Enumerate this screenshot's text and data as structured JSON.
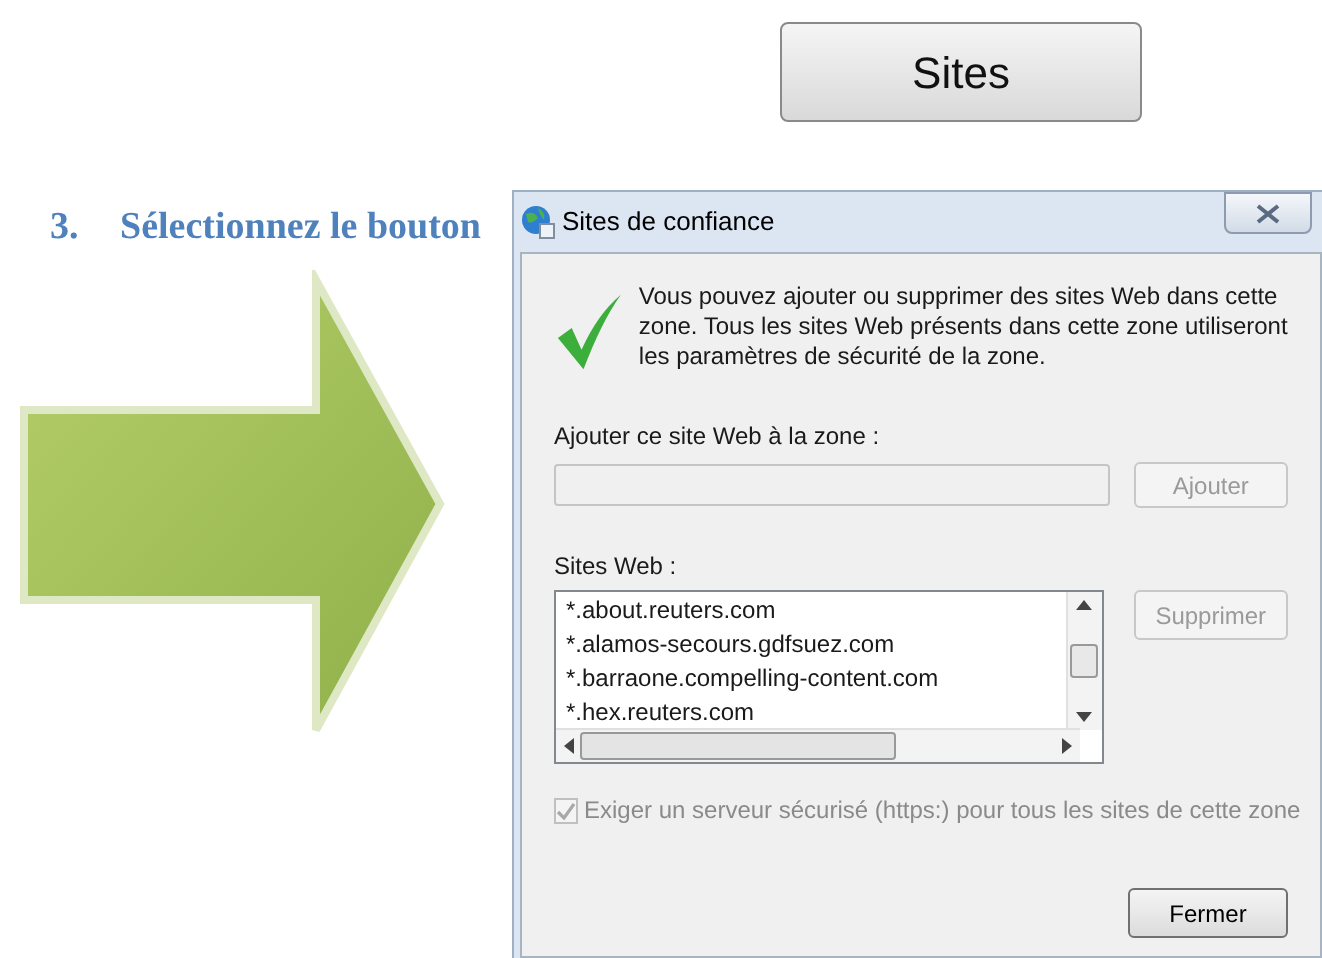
{
  "heading": {
    "number": "3.",
    "text": "Sélectionnez le bouton"
  },
  "sites_button": {
    "label": "Sites"
  },
  "dialog": {
    "title": "Sites de confiance",
    "message": "Vous pouvez ajouter ou supprimer des sites Web dans cette zone. Tous les sites Web présents dans cette zone utiliseront les paramètres de sécurité de la zone.",
    "add_label": "Ajouter ce site Web à la zone :",
    "add_button": {
      "label": "Ajouter",
      "disabled": true
    },
    "list_label": "Sites Web :",
    "sites": [
      "*.about.reuters.com",
      "*.alamos-secours.gdfsuez.com",
      "*.barraone.compelling-content.com",
      "*.hex.reuters.com"
    ],
    "remove_button": {
      "label": "Supprimer",
      "disabled": true
    },
    "https_checkbox": {
      "label": "Exiger un serveur sécurisé (https:) pour tous les sites de cette zone",
      "checked": true,
      "disabled": true
    },
    "close_button": {
      "label": "Fermer",
      "disabled": false
    }
  }
}
